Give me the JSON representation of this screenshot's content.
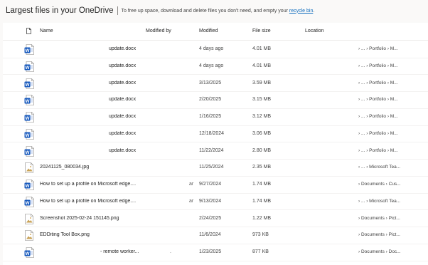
{
  "header": {
    "title": "Largest files in your OneDrive",
    "subtitle": "To free up space, download and delete files you don't need, and empty your",
    "recycle_link": "recycle bin",
    "subtitle_end": "."
  },
  "columns": {
    "name": "Name",
    "modified_by": "Modified by",
    "modified": "Modified",
    "file_size": "File size",
    "location": "Location"
  },
  "rows": [
    {
      "icon": "word-icon",
      "name": "update.docx",
      "modified_by": "",
      "modified": "4 days ago",
      "size": "4.01 MB",
      "location": "› ... › Portfolio › M..."
    },
    {
      "icon": "word-icon",
      "name": "update.docx",
      "modified_by": "",
      "modified": "4 days ago",
      "size": "4.01 MB",
      "location": "› ... › Portfolio › M..."
    },
    {
      "icon": "word-icon",
      "name": "update.docx",
      "modified_by": "",
      "modified": "3/13/2025",
      "size": "3.59 MB",
      "location": "› ... › Portfolio › M..."
    },
    {
      "icon": "word-icon",
      "name": "update.docx",
      "modified_by": "",
      "modified": "2/20/2025",
      "size": "3.15 MB",
      "location": "› ... › Portfolio › M..."
    },
    {
      "icon": "word-icon",
      "name": "update.docx",
      "modified_by": "",
      "modified": "1/16/2025",
      "size": "3.12 MB",
      "location": "› ... › Portfolio › M..."
    },
    {
      "icon": "word-icon",
      "name": "update.docx",
      "modified_by": "",
      "modified": "12/18/2024",
      "size": "3.06 MB",
      "location": "› ... › Portfolio › M..."
    },
    {
      "icon": "word-icon",
      "name": "update.docx",
      "modified_by": "",
      "modified": "11/22/2024",
      "size": "2.80 MB",
      "location": "› ... › Portfolio › M..."
    },
    {
      "icon": "image-icon",
      "name": "20241125_080034.jpg",
      "modified_by": "",
      "modified": "11/25/2024",
      "size": "2.35 MB",
      "location": "› ... › Microsoft Tea..."
    },
    {
      "icon": "word-icon",
      "name": "How to set up a profile on Microsoft edge....",
      "modified_by": "ar",
      "modified": "9/27/2024",
      "size": "1.74 MB",
      "location": "› Documents › Cus..."
    },
    {
      "icon": "word-icon",
      "name": "How to set up a profile on Microsoft edge....",
      "modified_by": "ar",
      "modified": "9/13/2024",
      "size": "1.74 MB",
      "location": "› ... › Microsoft Tea..."
    },
    {
      "icon": "image-icon",
      "name": "Screenshot 2025-02-24 151145.png",
      "modified_by": "",
      "modified": "2/24/2025",
      "size": "1.22 MB",
      "location": "› Documents › Pict..."
    },
    {
      "icon": "image-icon",
      "name": "EDDiting Tool Box.png",
      "modified_by": "",
      "modified": "11/6/2024",
      "size": "973 KB",
      "location": "› Documents › Pict..."
    },
    {
      "icon": "word-icon",
      "name": "- remote worker...",
      "modified_by": ".",
      "modified": "1/23/2025",
      "size": "877 KB",
      "location": "› Documents › Doc..."
    }
  ],
  "colors": {
    "word_blue": "#185abd",
    "link_blue": "#0f6cbd"
  }
}
